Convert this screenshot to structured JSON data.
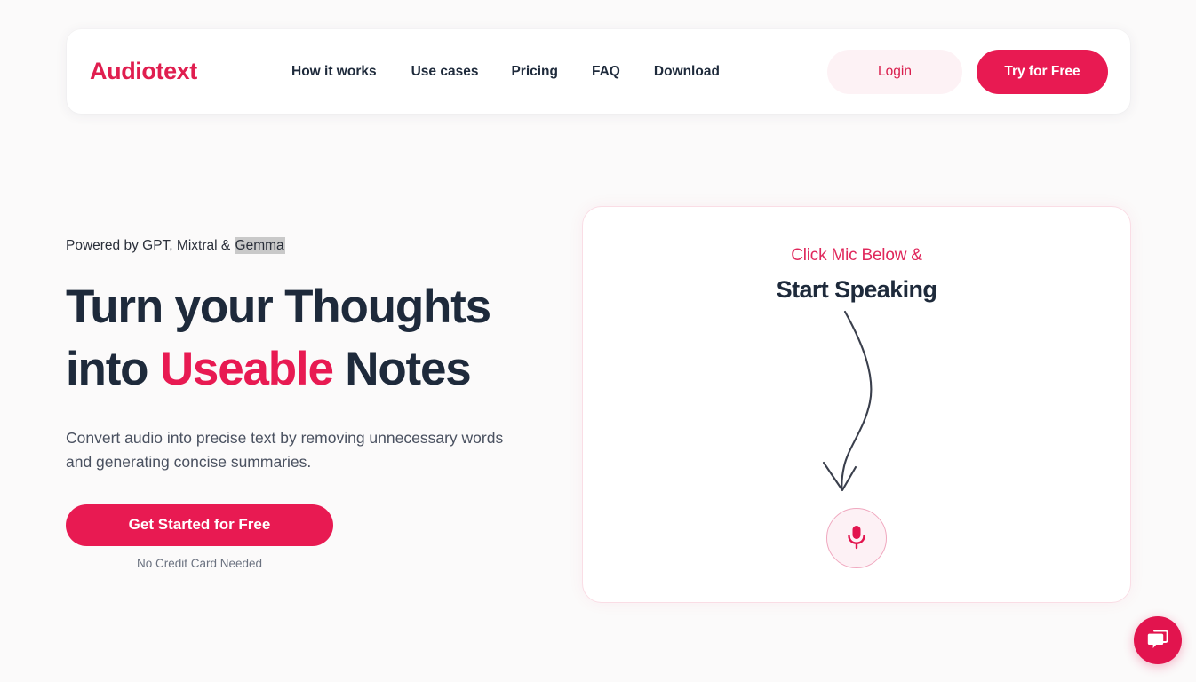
{
  "colors": {
    "brand": "#e01e4f",
    "accent": "#e81a52",
    "dark": "#1e2a3b",
    "muted": "#6b7280",
    "page_bg": "#fbfafa",
    "login_bg": "#fdf2f5",
    "card_border": "#fadde5",
    "mic_bg": "#fdf1f5",
    "mic_ring": "#f0a8bf",
    "highlight_bg": "#c9c9c9",
    "chat_bg": "#e2144e"
  },
  "header": {
    "brand": "Audiotext",
    "nav": [
      {
        "label": "How it works",
        "name": "nav-how-it-works"
      },
      {
        "label": "Use cases",
        "name": "nav-use-cases"
      },
      {
        "label": "Pricing",
        "name": "nav-pricing"
      },
      {
        "label": "FAQ",
        "name": "nav-faq"
      },
      {
        "label": "Download",
        "name": "nav-download"
      }
    ],
    "login_label": "Login",
    "try_label": "Try for Free"
  },
  "hero": {
    "eyebrow_prefix": "Powered by GPT, Mixtral & ",
    "eyebrow_highlight": "Gemma",
    "headline_line1": "Turn your Thoughts",
    "headline_line2_pre": "into ",
    "headline_line2_accent": "Useable",
    "headline_line2_post": " Notes",
    "subtext": "Convert audio into precise text by removing unnecessary words and generating concise summaries.",
    "cta_label": "Get Started for Free",
    "cta_note": "No Credit Card Needed"
  },
  "mic_card": {
    "kicker": "Click Mic Below &",
    "title": "Start Speaking",
    "arrow_icon": "curved-down-arrow-icon",
    "mic_icon": "microphone-icon"
  },
  "chat": {
    "icon": "chat-bubble-icon"
  }
}
